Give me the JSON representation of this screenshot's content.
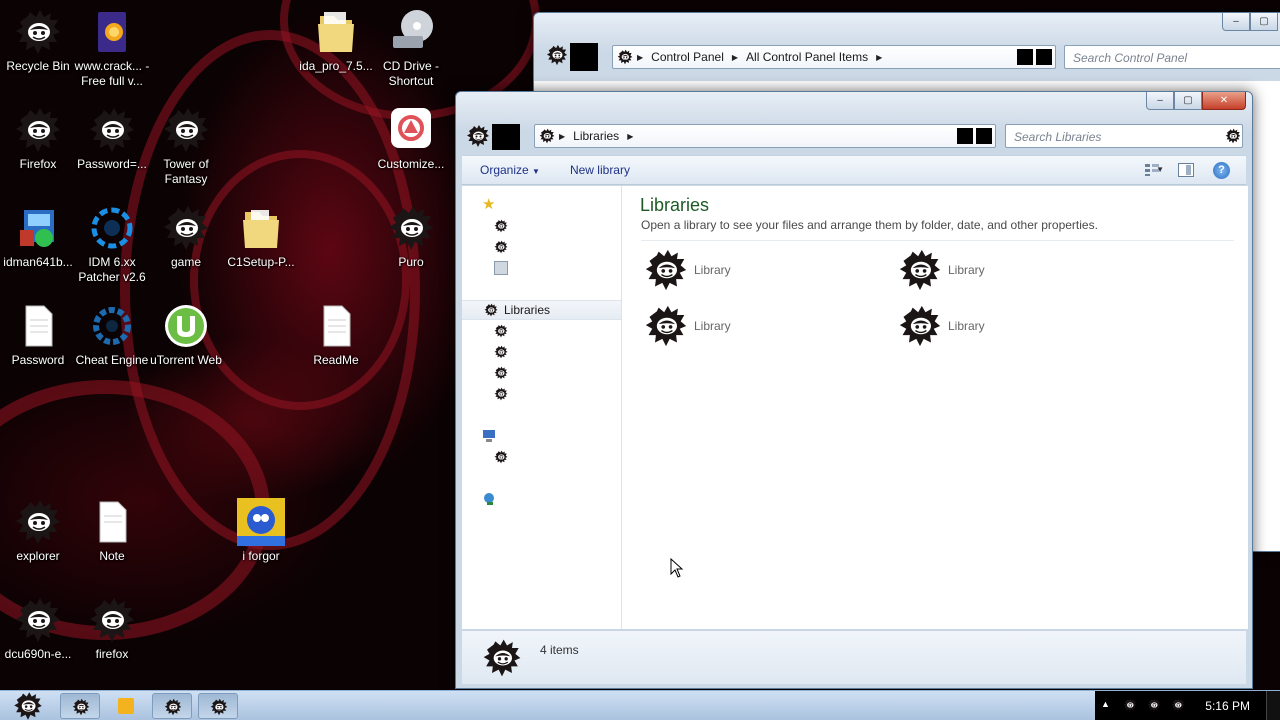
{
  "desktop": {
    "icons": [
      {
        "label": "Recycle Bin",
        "icon": "mascot-icon"
      },
      {
        "label": "www.crack... - Free full v...",
        "icon": "file-icon"
      },
      {
        "label": "ida_pro_7.5...",
        "icon": "folder-icon"
      },
      {
        "label": "CD Drive - Shortcut",
        "icon": "cd-drive-icon"
      },
      {
        "label": "Firefox",
        "icon": "mascot-icon"
      },
      {
        "label": "Password=...",
        "icon": "mascot-icon"
      },
      {
        "label": "Tower of Fantasy",
        "icon": "mascot-icon"
      },
      {
        "label": "Customize...",
        "icon": "customize-icon"
      },
      {
        "label": "idman641b...",
        "icon": "installer-icon"
      },
      {
        "label": "IDM 6.xx Patcher v2.6",
        "icon": "patcher-icon"
      },
      {
        "label": "game",
        "icon": "mascot-icon"
      },
      {
        "label": "C1Setup-P...",
        "icon": "folder-icon"
      },
      {
        "label": "Puro",
        "icon": "mascot-icon"
      },
      {
        "label": "Password",
        "icon": "text-file-icon"
      },
      {
        "label": "Cheat Engine",
        "icon": "cheat-engine-icon"
      },
      {
        "label": "uTorrent Web",
        "icon": "utorrent-icon"
      },
      {
        "label": "ReadMe",
        "icon": "text-file-icon"
      },
      {
        "label": "explorer",
        "icon": "mascot-icon"
      },
      {
        "label": "Note",
        "icon": "text-file-icon"
      },
      {
        "label": "i forgor",
        "icon": "picture-icon"
      },
      {
        "label": "dcu690n-e...",
        "icon": "mascot-icon"
      },
      {
        "label": "firefox",
        "icon": "mascot-icon"
      }
    ]
  },
  "control_panel_window": {
    "breadcrumbs": [
      "Control Panel",
      "All Control Panel Items"
    ],
    "search_placeholder": "Search Control Panel"
  },
  "libraries_window": {
    "breadcrumbs": [
      "Libraries"
    ],
    "search_placeholder": "Search Libraries",
    "toolbar": {
      "organize": "Organize",
      "new_library": "New library"
    },
    "nav": {
      "libraries": "Libraries"
    },
    "heading": "Libraries",
    "description": "Open a library to see your files and arrange them by folder, date, and other properties.",
    "libraries": [
      "Library",
      "Library",
      "Library",
      "Library"
    ],
    "status": "4 items"
  },
  "taskbar": {
    "clock": "5:16 PM"
  },
  "colors": {
    "heading_green": "#1e5a24",
    "toolbar_link": "#1e3287",
    "close_button": "#c6402b"
  }
}
